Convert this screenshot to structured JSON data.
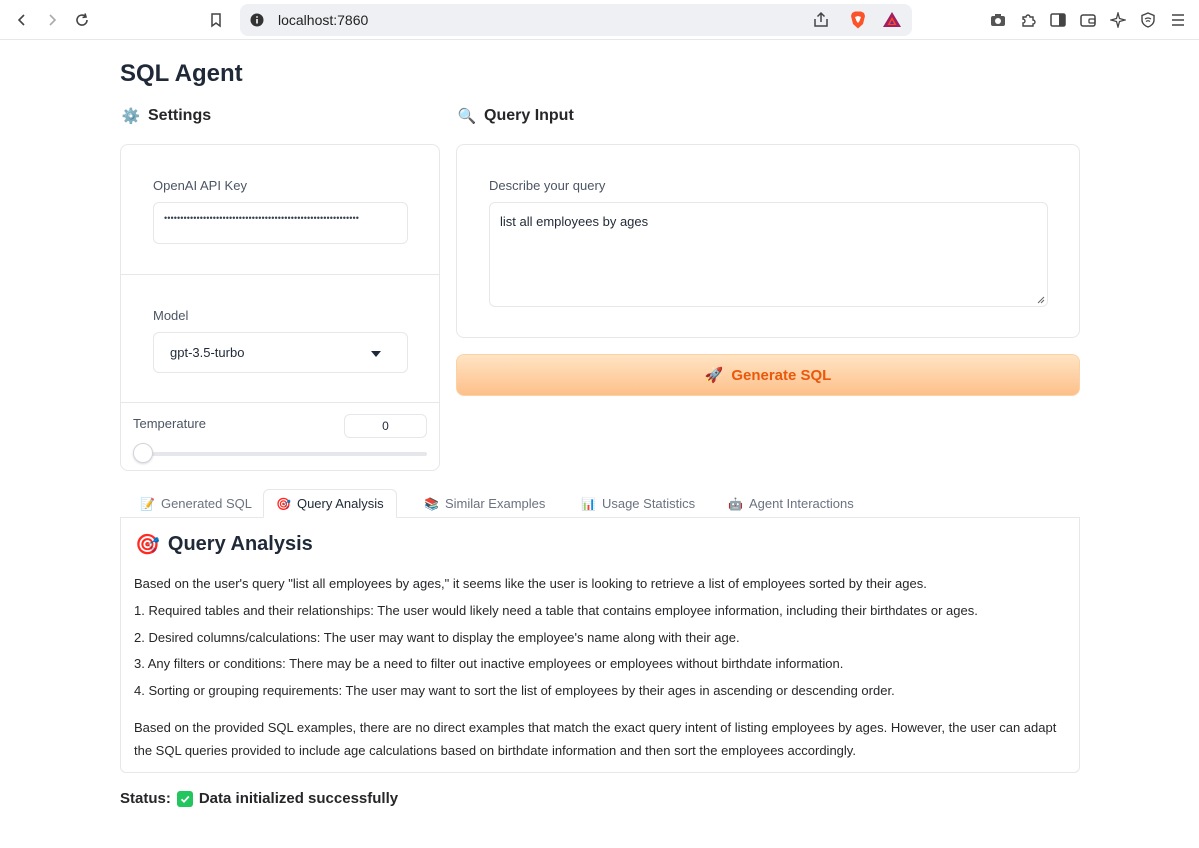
{
  "browser": {
    "url": "localhost:7860"
  },
  "app": {
    "title": "SQL Agent"
  },
  "settings": {
    "heading": "Settings",
    "heading_emoji": "⚙️",
    "api_key_label": "OpenAI API Key",
    "api_key_value": "••••••••••••••••••••••••••••••••••••••••••••••••••••••••••••",
    "model_label": "Model",
    "model_value": "gpt-3.5-turbo",
    "temperature_label": "Temperature",
    "temperature_value": "0"
  },
  "query": {
    "heading": "Query Input",
    "heading_emoji": "🔍",
    "describe_label": "Describe your query",
    "text": "list all employees by ages",
    "generate_label": "Generate SQL",
    "generate_emoji": "🚀"
  },
  "tabs": [
    {
      "emoji": "📝",
      "label": "Generated SQL"
    },
    {
      "emoji": "🎯",
      "label": "Query Analysis"
    },
    {
      "emoji": "📚",
      "label": "Similar Examples"
    },
    {
      "emoji": "📊",
      "label": "Usage Statistics"
    },
    {
      "emoji": "🤖",
      "label": "Agent Interactions"
    }
  ],
  "active_tab": "Query Analysis",
  "analysis": {
    "title": "Query Analysis",
    "title_emoji": "🎯",
    "intro": "Based on the user's query \"list all employees by ages,\" it seems like the user is looking to retrieve a list of employees sorted by their ages.",
    "points": [
      "1. Required tables and their relationships: The user would likely need a table that contains employee information, including their birthdates or ages.",
      "2. Desired columns/calculations: The user may want to display the employee's name along with their age.",
      "3. Any filters or conditions: There may be a need to filter out inactive employees or employees without birthdate information.",
      "4. Sorting or grouping requirements: The user may want to sort the list of employees by their ages in ascending or descending order."
    ],
    "conclusion": "Based on the provided SQL examples, there are no direct examples that match the exact query intent of listing employees by ages. However, the user can adapt the SQL queries provided to include age calculations based on birthdate information and then sort the employees accordingly."
  },
  "status": {
    "label": "Status:",
    "message": "Data initialized successfully"
  },
  "colors": {
    "accent": "#ea580c",
    "button_gradient_top": "#ffe4c4",
    "button_gradient_bottom": "#fdc08a",
    "success": "#22c55e"
  }
}
